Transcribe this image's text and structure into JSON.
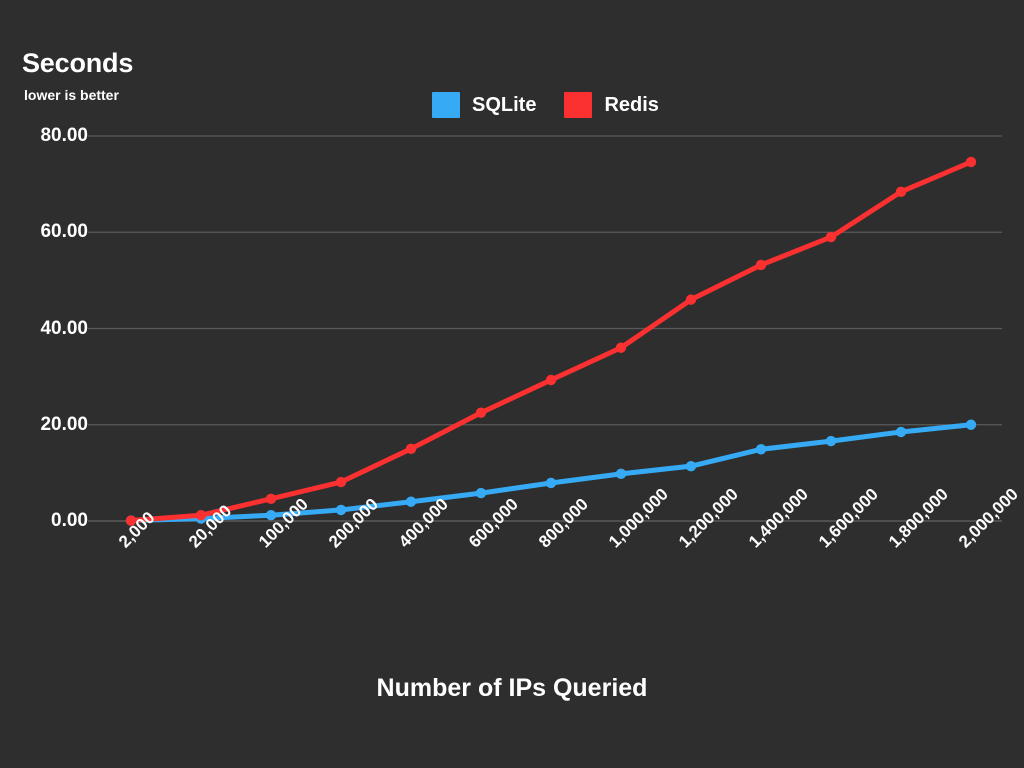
{
  "chart_data": {
    "type": "line",
    "title": "Seconds",
    "subtitle": "lower is better",
    "xlabel": "Number of IPs Queried",
    "ylabel": "Seconds",
    "categories": [
      "2,000",
      "20,000",
      "100,000",
      "200,000",
      "400,000",
      "600,000",
      "800,000",
      "1,000,000",
      "1,200,000",
      "1,400,000",
      "1,600,000",
      "1,800,000",
      "2,000,000"
    ],
    "series": [
      {
        "name": "SQLite",
        "color": "#36aaf5",
        "values": [
          0.1,
          0.5,
          1.2,
          2.3,
          4.0,
          5.8,
          7.9,
          9.8,
          11.4,
          14.9,
          16.6,
          18.5,
          20.0
        ]
      },
      {
        "name": "Redis",
        "color": "#fb3030",
        "values": [
          0.1,
          1.2,
          4.6,
          8.1,
          15.0,
          22.5,
          29.3,
          36.0,
          46.0,
          53.2,
          59.0,
          68.4,
          74.6
        ]
      }
    ],
    "ylim": [
      0,
      80
    ],
    "y_ticks": [
      "0.00",
      "20.00",
      "40.00",
      "60.00",
      "80.00"
    ],
    "y_tick_values": [
      0,
      20,
      40,
      60,
      80
    ],
    "grid": true,
    "legend_position": "top-center",
    "background_color": "#2e2e2e",
    "gridline_color": "#5a5a5a",
    "text_color": "#ffffff"
  }
}
